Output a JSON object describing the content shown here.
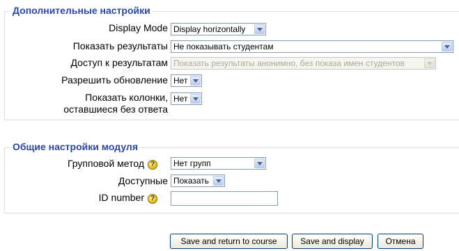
{
  "advanced": {
    "legend": "Дополнительные настройки",
    "display_mode": {
      "label": "Display Mode",
      "value": "Display horizontally"
    },
    "show_results": {
      "label": "Показать результаты",
      "value": "Не показывать студентам"
    },
    "results_access": {
      "label": "Доступ к результатам",
      "value": "Показать результаты анонимно, без показа имен студентов"
    },
    "allow_update": {
      "label": "Разрешить обновление",
      "value": "Нет"
    },
    "show_unanswered": {
      "label_line1": "Показать колонки,",
      "label_line2": "оставшиеся без ответа",
      "value": "Нет"
    }
  },
  "module": {
    "legend": "Общие настройки модуля",
    "group_mode": {
      "label": "Групповой метод",
      "value": "Нет групп"
    },
    "visible": {
      "label": "Доступные",
      "value": "Показать"
    },
    "id_number": {
      "label": "ID number",
      "value": ""
    }
  },
  "buttons": {
    "save_return": "Save and return to course",
    "save_display": "Save and display",
    "cancel": "Отмена"
  },
  "icons": {
    "help": "help-icon",
    "dropdown": "chevron-down-icon"
  },
  "colors": {
    "legend": "#2a46a8",
    "border": "#dddddd",
    "button_border": "#003c74"
  }
}
